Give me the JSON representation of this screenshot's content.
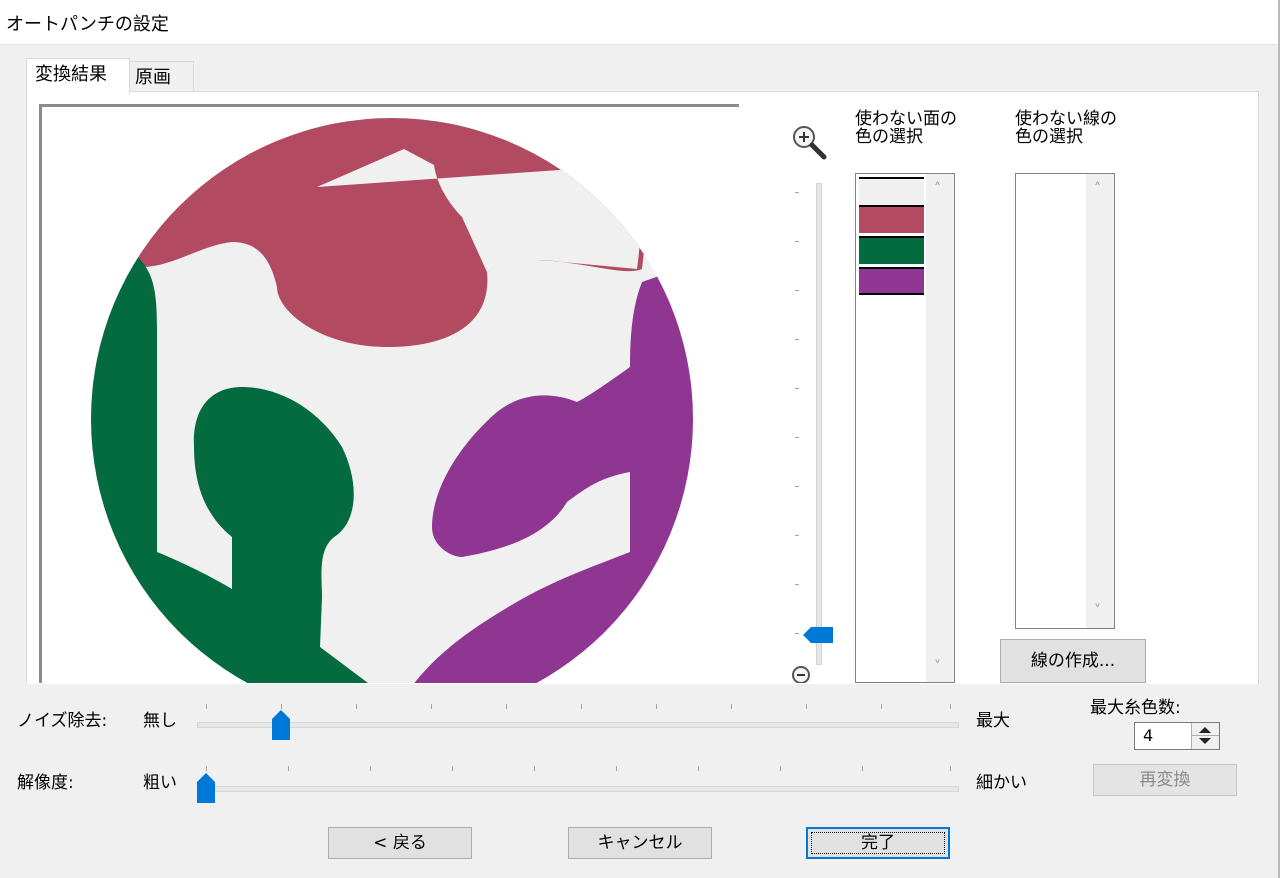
{
  "window": {
    "title": "オートパンチの設定"
  },
  "tabs": [
    {
      "label": "変換結果",
      "active": true
    },
    {
      "label": "原画",
      "active": false
    }
  ],
  "preview": {
    "colors": {
      "background": "#ffffff",
      "base": "#f0f0f0",
      "red": "#b24b62",
      "green": "#046a40",
      "purple": "#8f3592"
    }
  },
  "zoom": {
    "level_fraction": 0.0
  },
  "face_colors": {
    "label_line1": "使わない面の",
    "label_line2": "色の選択",
    "swatches": [
      "#f0f0f0",
      "#b24b62",
      "#046a40",
      "#8f3592"
    ]
  },
  "line_colors": {
    "label_line1": "使わない線の",
    "label_line2": "色の選択",
    "swatches": []
  },
  "create_line_button": "線の作成...",
  "noise": {
    "label": "ノイズ除去:",
    "min_label": "無し",
    "max_label": "最大",
    "value_fraction": 0.11
  },
  "resolution": {
    "label": "解像度:",
    "min_label": "粗い",
    "max_label": "細かい",
    "value_fraction": 0.0
  },
  "max_thread_colors": {
    "label": "最大糸色数:",
    "value": "4"
  },
  "reconvert_button": "再変換",
  "buttons": {
    "back": "< 戻る",
    "cancel": "キャンセル",
    "finish": "完了"
  },
  "accent_color": "#0078d7"
}
